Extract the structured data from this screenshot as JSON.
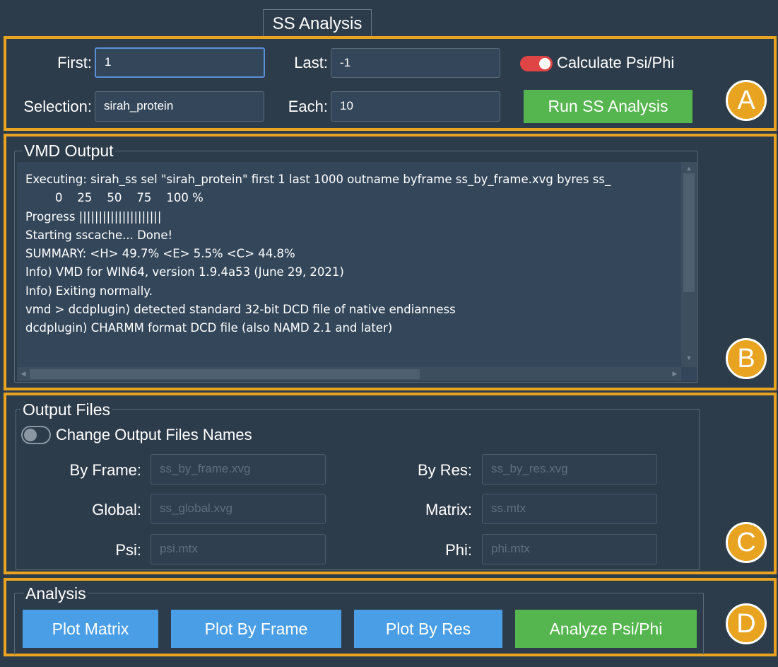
{
  "tab": {
    "label": "SS Analysis"
  },
  "badges": {
    "a": "A",
    "b": "B",
    "c": "C",
    "d": "D"
  },
  "params": {
    "first_label": "First:",
    "first_value": "1",
    "last_label": "Last:",
    "last_value": "-1",
    "selection_label": "Selection:",
    "selection_value": "sirah_protein",
    "each_label": "Each:",
    "each_value": "10",
    "calc_label": "Calculate Psi/Phi",
    "calc_enabled": true,
    "run_label": "Run SS Analysis"
  },
  "vmd": {
    "title": "VMD Output",
    "lines": [
      "Executing: sirah_ss sel \"sirah_protein\" first 1 last 1000 outname byframe ss_by_frame.xvg byres ss_",
      "        0    25    50    75    100 %",
      "Progress |||||||||||||||||||||",
      "Starting sscache... Done!",
      "SUMMARY: <H> 49.7% <E> 5.5% <C> 44.8%",
      "Info) VMD for WIN64, version 1.9.4a53 (June 29, 2021)",
      "Info) Exiting normally.",
      "vmd > dcdplugin) detected standard 32-bit DCD file of native endianness",
      "dcdplugin) CHARMM format DCD file (also NAMD 2.1 and later)"
    ]
  },
  "output_files": {
    "title": "Output Files",
    "change_label": "Change Output Files Names",
    "change_enabled": false,
    "byframe_label": "By Frame:",
    "byframe_value": "ss_by_frame.xvg",
    "byres_label": "By Res:",
    "byres_value": "ss_by_res.xvg",
    "global_label": "Global:",
    "global_value": "ss_global.xvg",
    "matrix_label": "Matrix:",
    "matrix_value": "ss.mtx",
    "psi_label": "Psi:",
    "psi_value": "psi.mtx",
    "phi_label": "Phi:",
    "phi_value": "phi.mtx"
  },
  "analysis": {
    "title": "Analysis",
    "plot_matrix": "Plot Matrix",
    "plot_by_frame": "Plot By Frame",
    "plot_by_res": "Plot By Res",
    "analyze_psiphi": "Analyze Psi/Phi"
  },
  "colors": {
    "background": "#2d3c4b",
    "highlight": "#e8a320",
    "green_button": "#55b54e",
    "blue_button": "#4a9ee6",
    "toggle_on": "#e04545"
  }
}
